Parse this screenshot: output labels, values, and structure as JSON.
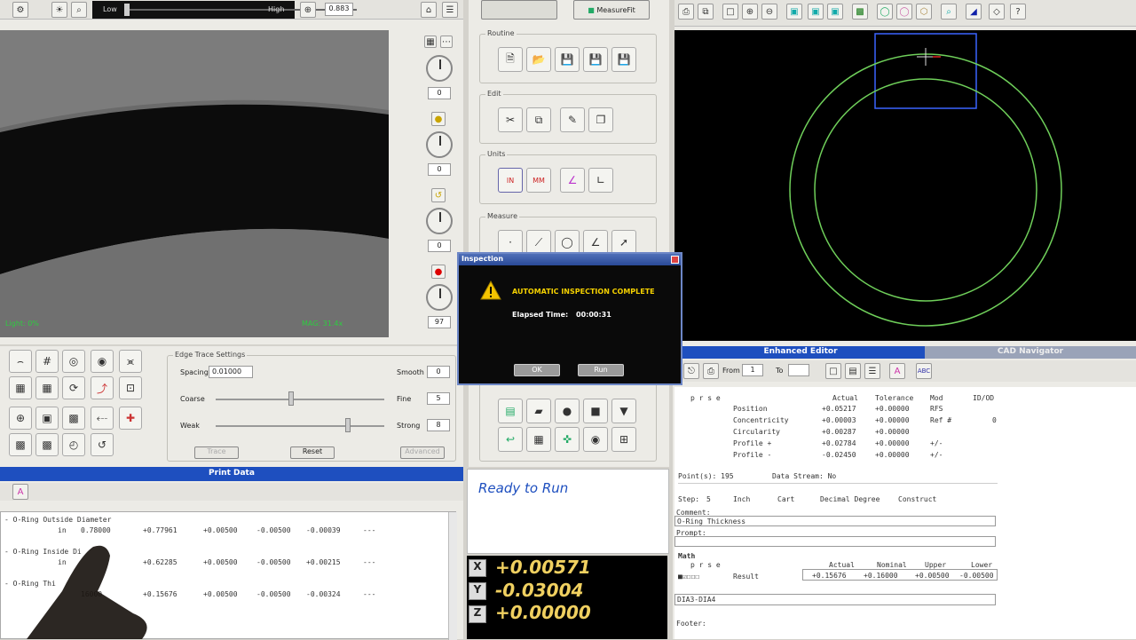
{
  "camera_toolbar": {
    "low": "Low",
    "high": "High",
    "value": "0.883"
  },
  "camera_view": {
    "light": "Light: 0%",
    "mag": "MAG: 31.4x"
  },
  "side_controls": {
    "values": [
      "0",
      "0",
      "0",
      "97"
    ]
  },
  "top_buttons": {
    "measurefit": "MeasureFit"
  },
  "groups": {
    "routine": "Routine",
    "edit": "Edit",
    "units": "Units",
    "measure": "Measure"
  },
  "edge_trace": {
    "title": "Edge Trace Settings",
    "spacing_label": "Spacing",
    "spacing_value": "0.01000",
    "smooth_label": "Smooth",
    "smooth_value": "0",
    "coarse_label": "Coarse",
    "fine_label": "Fine",
    "fine_value": "5",
    "weak_label": "Weak",
    "strong_label": "Strong",
    "strong_value": "8",
    "trace": "Trace",
    "reset": "Reset",
    "advanced": "Advanced"
  },
  "dialog": {
    "title": "Inspection",
    "message": "AUTOMATIC INSPECTION COMPLETE",
    "elapsed_label": "Elapsed Time:",
    "elapsed_value": "00:00:31",
    "ok": "OK",
    "run": "Run"
  },
  "print_data": {
    "title": "Print Data",
    "rows": [
      {
        "label": "- O-Ring Outside Diameter",
        "unit": "in",
        "nominal": "0.78000",
        "actual": "+0.77961",
        "upper": "+0.00500",
        "lower": "-0.00500",
        "dev": "-0.00039",
        "tail": "---"
      },
      {
        "label": "- O-Ring Inside Di",
        "unit": "in",
        "nominal": "",
        "actual": "+0.62285",
        "upper": "+0.00500",
        "lower": "-0.00500",
        "dev": "+0.00215",
        "tail": "---"
      },
      {
        "label": "- O-Ring Thi",
        "unit": "",
        "nominal": "16000",
        "actual": "+0.15676",
        "upper": "+0.00500",
        "lower": "-0.00500",
        "dev": "-0.00324",
        "tail": "---"
      }
    ]
  },
  "status": {
    "text": "Ready to Run"
  },
  "dro": {
    "x": "+0.00571",
    "y": "-0.03004",
    "z": "+0.00000"
  },
  "editor": {
    "tab_enhanced": "Enhanced Editor",
    "tab_cad": "CAD Navigator",
    "from_label": "From",
    "from_value": "1",
    "to_label": "To",
    "header": {
      "pse": "p r s e",
      "actual": "Actual",
      "tolerance": "Tolerance",
      "mod": "Mod",
      "idod": "ID/OD"
    },
    "results": [
      {
        "name": "Position",
        "actual": "+0.05217",
        "tol": "+0.00000",
        "mod": "RFS",
        "extra": ""
      },
      {
        "name": "Concentricity",
        "actual": "+0.00003",
        "tol": "+0.00000",
        "mod": "Ref #",
        "extra": "0"
      },
      {
        "name": "Circularity",
        "actual": "+0.00287",
        "tol": "+0.00000",
        "mod": "",
        "extra": ""
      },
      {
        "name": "Profile +",
        "actual": "+0.02784",
        "tol": "+0.00000",
        "mod": "+/-",
        "extra": ""
      },
      {
        "name": "Profile -",
        "actual": "-0.02450",
        "tol": "+0.00000",
        "mod": "+/-",
        "extra": ""
      }
    ],
    "points": "Point(s): 195",
    "datastream": "Data Stream: No",
    "step_label": "Step:",
    "step_value": "5",
    "inch": "Inch",
    "cart": "Cart",
    "decimal": "Decimal Degree",
    "construct": "Construct",
    "comment_label": "Comment:",
    "comment_value": "O-Ring Thickness",
    "prompt_label": "Prompt:",
    "math_label": "Math",
    "math_header": {
      "pse": "p r s e",
      "actual": "Actual",
      "nominal": "Nominal",
      "upper": "Upper",
      "lower": "Lower"
    },
    "result_label": "Result",
    "math_values": {
      "actual": "+0.15676",
      "nominal": "+0.16000",
      "upper": "+0.00500",
      "lower": "-0.00500"
    },
    "formula": "DIA3-DIA4",
    "footer_label": "Footer:"
  }
}
